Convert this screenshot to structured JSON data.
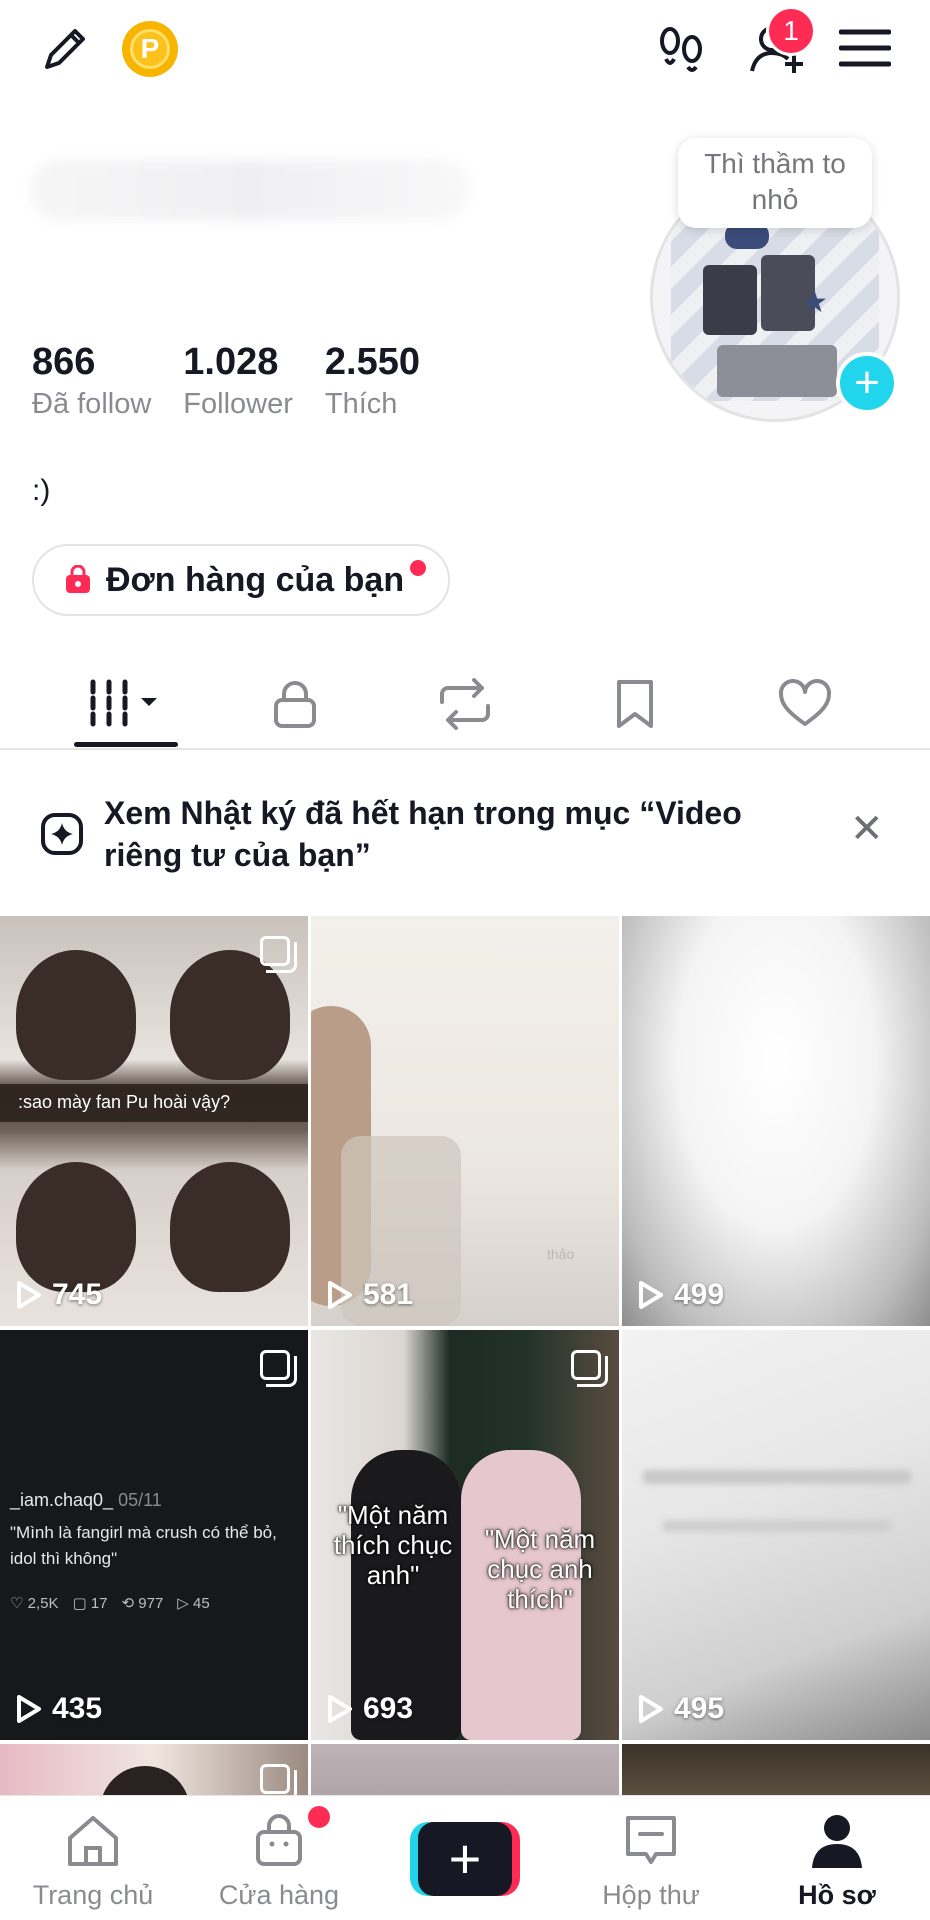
{
  "header": {
    "coin_letter": "P",
    "notification_count": "1"
  },
  "profile": {
    "stats": [
      {
        "value": "866",
        "label": "Đã follow"
      },
      {
        "value": "1.028",
        "label": "Follower"
      },
      {
        "value": "2.550",
        "label": "Thích"
      }
    ],
    "avatar_bubble": "Thì thầm to nhỏ",
    "bio": ":)",
    "orders_label": "Đơn hàng của bạn"
  },
  "tabs": [
    "videos",
    "private",
    "reposts",
    "saved",
    "liked"
  ],
  "banner": {
    "text": "Xem Nhật ký đã hết hạn trong mục “Video riêng tư của bạn”"
  },
  "videos": [
    {
      "views": "745",
      "caption": ":sao mày fan Pu hoài vậy?"
    },
    {
      "views": "581",
      "watermark": "thảo"
    },
    {
      "views": "499"
    },
    {
      "views": "435",
      "user": "_iam.chaq0_",
      "date": "05/11",
      "quote": "\"Mình là fangirl mà crush có thể bỏ, idol thì không\"",
      "likes": "2,5K",
      "comments": "17",
      "reposts": "977",
      "shares": "45"
    },
    {
      "views": "693",
      "overlay_left": "\"Một năm thích chục anh\"",
      "overlay_right": "\"Một năm chục anh thích\""
    },
    {
      "views": "495"
    }
  ],
  "bottom_nav": {
    "home": "Trang chủ",
    "shop": "Cửa hàng",
    "inbox": "Hộp thư",
    "profile": "Hồ sơ"
  },
  "colors": {
    "accent_red": "#fe2c55",
    "accent_cyan": "#20d5ec",
    "text_primary": "#161823",
    "text_secondary": "#8a8b91"
  }
}
